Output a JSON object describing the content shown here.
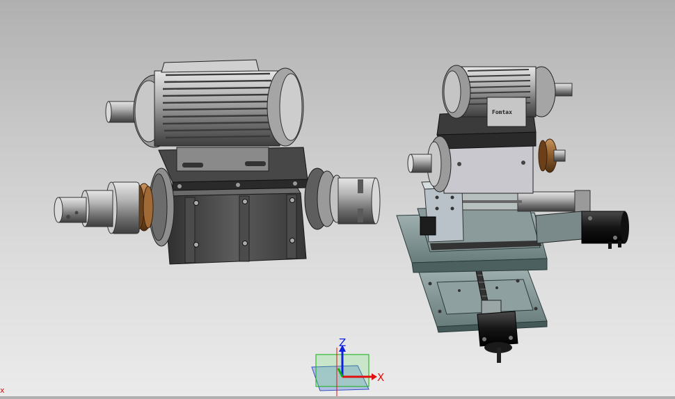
{
  "viewport": {
    "triad": {
      "z_label": "Z",
      "x_label": "X"
    },
    "corner_mark": "x",
    "motor_badge": "Fomtax"
  },
  "colors": {
    "background_top": "#b0b0b0",
    "background_bottom": "#ebebeb",
    "axis_x": "#e01010",
    "axis_y": "#10b010",
    "axis_z": "#1020e0",
    "metal": "#a8a8a8",
    "housing": "#555555",
    "base_plate": "#7d9090",
    "pulley": "#8a5a2b"
  }
}
